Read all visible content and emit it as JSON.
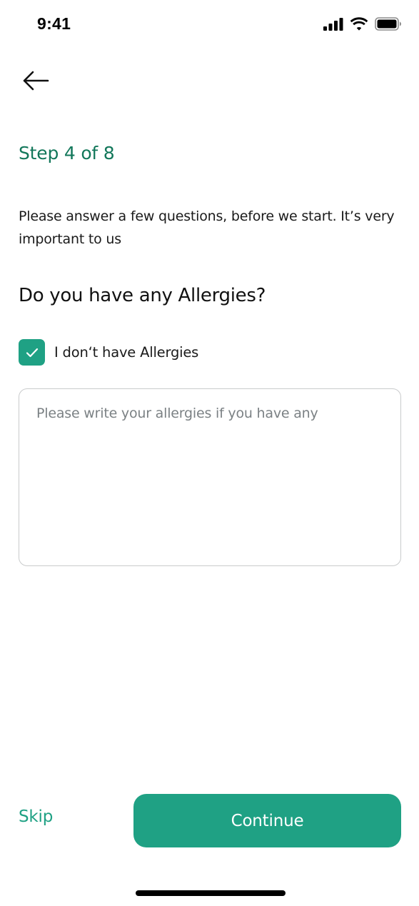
{
  "status_bar": {
    "time": "9:41",
    "icons": [
      "cellular-signal-icon",
      "wifi-icon",
      "battery-icon"
    ]
  },
  "header": {
    "back_icon": "arrow-left-icon"
  },
  "step": {
    "label": "Step 4 of 8"
  },
  "intro": {
    "text": "Please answer a few questions, before we start. It’s very important to us"
  },
  "question": {
    "title": "Do you have any Allergies?"
  },
  "no_allergies": {
    "label": "I don‘t have Allergies",
    "checked": true,
    "check_icon": "checkmark-icon"
  },
  "allergies_input": {
    "value": "",
    "placeholder": "Please write your allergies if you have any"
  },
  "footer": {
    "skip_label": "Skip",
    "continue_label": "Continue"
  },
  "colors": {
    "accent": "#1fa184",
    "step_text": "#12775a",
    "input_border": "#c9cbcc",
    "placeholder": "#7b8184"
  }
}
